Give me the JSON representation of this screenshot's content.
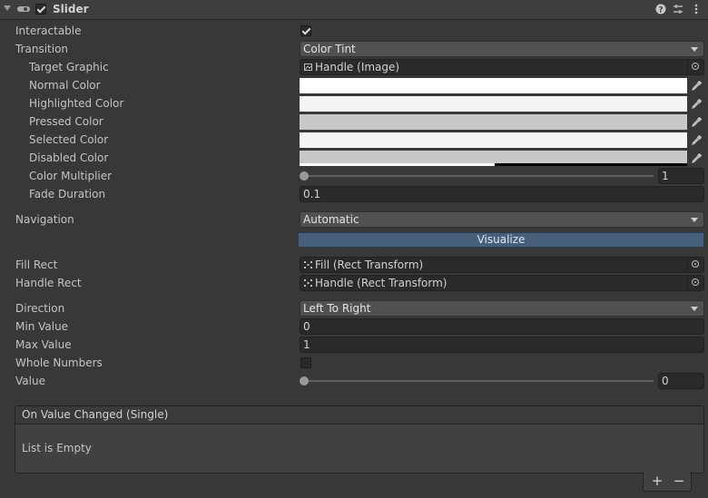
{
  "header": {
    "title": "Slider",
    "enabled": true,
    "icons": [
      "visibility-icon",
      "help-icon",
      "presets-icon",
      "more-icon"
    ]
  },
  "fields": {
    "interactable": {
      "label": "Interactable",
      "checked": true
    },
    "transition": {
      "label": "Transition",
      "value": "Color Tint"
    },
    "target_graphic": {
      "label": "Target Graphic",
      "value": "Handle (Image)"
    },
    "normal_color": {
      "label": "Normal Color",
      "color": "#ffffff"
    },
    "highlighted_color": {
      "label": "Highlighted Color",
      "color": "#f5f5f5"
    },
    "pressed_color": {
      "label": "Pressed Color",
      "color": "#c8c8c8"
    },
    "selected_color": {
      "label": "Selected Color",
      "color": "#f5f5f5"
    },
    "disabled_color": {
      "label": "Disabled Color",
      "color": "#c8c8c8",
      "alpha": 0.5
    },
    "color_multiplier": {
      "label": "Color Multiplier",
      "value": "1",
      "fraction": 0.0
    },
    "fade_duration": {
      "label": "Fade Duration",
      "value": "0.1"
    },
    "navigation": {
      "label": "Navigation",
      "value": "Automatic"
    },
    "visualize": {
      "label": "Visualize"
    },
    "fill_rect": {
      "label": "Fill Rect",
      "value": "Fill (Rect Transform)"
    },
    "handle_rect": {
      "label": "Handle Rect",
      "value": "Handle (Rect Transform)"
    },
    "direction": {
      "label": "Direction",
      "value": "Left To Right"
    },
    "min_value": {
      "label": "Min Value",
      "value": "0"
    },
    "max_value": {
      "label": "Max Value",
      "value": "1"
    },
    "whole_numbers": {
      "label": "Whole Numbers",
      "checked": false
    },
    "value": {
      "label": "Value",
      "value": "0",
      "fraction": 0.0
    }
  },
  "event": {
    "title": "On Value Changed (Single)",
    "empty_text": "List is Empty",
    "add_label": "+",
    "remove_label": "−"
  },
  "colors": {
    "background": "#383838",
    "accent": "#46607c"
  }
}
